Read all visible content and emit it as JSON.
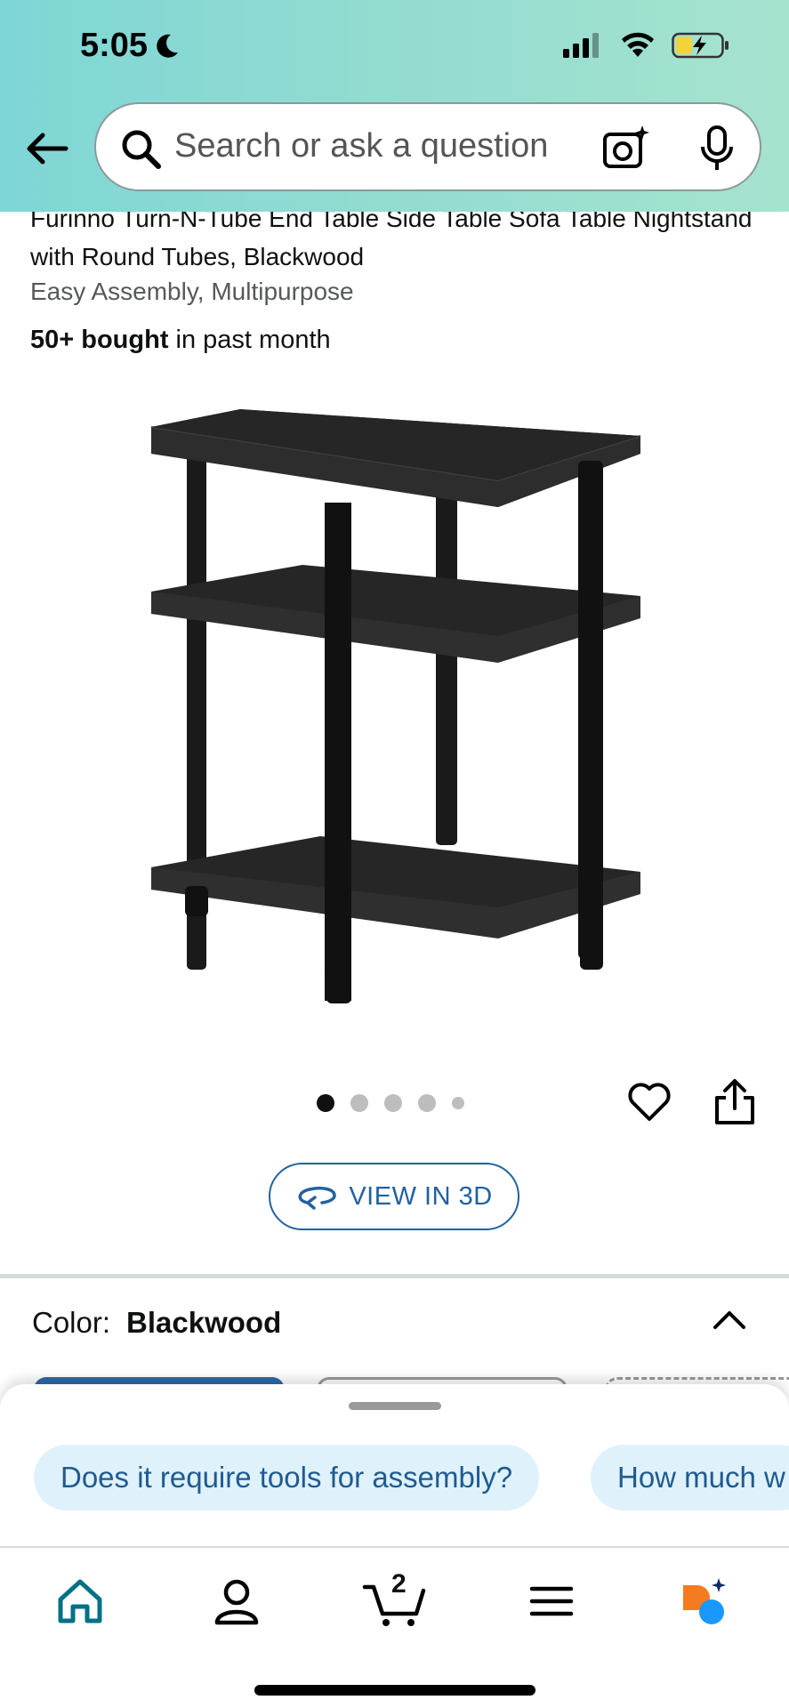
{
  "status_bar": {
    "time": "5:05"
  },
  "search": {
    "placeholder": "Search or ask a question"
  },
  "product": {
    "title": "Furinno Turn-N-Tube End Table Side Table Sofa Table Nightstand with Round Tubes, Blackwood",
    "subtitle": "Easy Assembly, Multipurpose",
    "bought_bold": "50+ bought",
    "bought_rest": " in past month"
  },
  "gallery": {
    "image_count": 5,
    "active_index": 0
  },
  "view3d": {
    "label": "VIEW IN 3D"
  },
  "color": {
    "label": "Color:",
    "value": "Blackwood"
  },
  "suggestions": [
    {
      "label": "Does it require tools for assembly?"
    },
    {
      "label": "How much w"
    }
  ],
  "nav": {
    "cart_count": "2"
  },
  "colors": {
    "accent_blue": "#2162a1",
    "chip_bg": "#dff1fb",
    "header_start": "#7fd6d6",
    "header_end": "#a6e3cf",
    "home_icon": "#007185"
  },
  "icons": [
    "back-arrow-icon",
    "search-icon",
    "camera-icon",
    "mic-icon",
    "heart-icon",
    "share-icon",
    "rotate-3d-icon",
    "chevron-up-icon",
    "home-icon",
    "account-icon",
    "cart-icon",
    "menu-icon",
    "rufus-icon"
  ]
}
